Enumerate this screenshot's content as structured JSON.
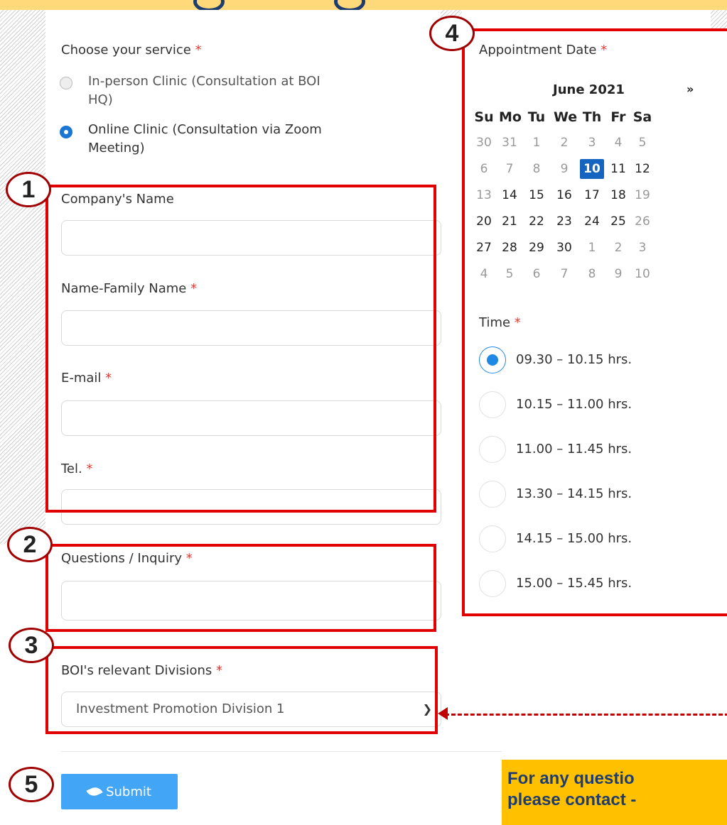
{
  "service": {
    "label": "Choose your service",
    "required_mark": "*",
    "options": [
      {
        "line1": "In-person Clinic (Consultation at BOI",
        "line2": "HQ)",
        "selected": false
      },
      {
        "line1": "Online Clinic (Consultation via Zoom",
        "line2": "Meeting)",
        "selected": true
      }
    ]
  },
  "fields": {
    "company_name": {
      "label": "Company's Name",
      "value": ""
    },
    "full_name": {
      "label": "Name-Family Name",
      "required_mark": "*",
      "value": ""
    },
    "email": {
      "label": "E-mail",
      "required_mark": "*",
      "value": ""
    },
    "tel": {
      "label": "Tel.",
      "required_mark": "*",
      "value": ""
    },
    "questions": {
      "label": "Questions / Inquiry",
      "required_mark": "*",
      "value": ""
    },
    "divisions": {
      "label": "BOI's relevant Divisions",
      "required_mark": "*",
      "selected": "Investment Promotion Division 1"
    }
  },
  "appointment": {
    "label": "Appointment Date",
    "required_mark": "*",
    "month": "June 2021",
    "next": "»",
    "weekdays": [
      "Su",
      "Mo",
      "Tu",
      "We",
      "Th",
      "Fr",
      "Sa"
    ],
    "weeks": [
      [
        "30",
        "31",
        "1",
        "2",
        "3",
        "4",
        "5"
      ],
      [
        "6",
        "7",
        "8",
        "9",
        "10",
        "11",
        "12"
      ],
      [
        "13",
        "14",
        "15",
        "16",
        "17",
        "18",
        "19"
      ],
      [
        "20",
        "21",
        "22",
        "23",
        "24",
        "25",
        "26"
      ],
      [
        "27",
        "28",
        "29",
        "30",
        "1",
        "2",
        "3"
      ],
      [
        "4",
        "5",
        "6",
        "7",
        "8",
        "9",
        "10"
      ]
    ],
    "selected_day": "10"
  },
  "time": {
    "label": "Time",
    "required_mark": "*",
    "slots": [
      "09.30 – 10.15 hrs.",
      "10.15 – 11.00 hrs.",
      "11.00 – 11.45 hrs.",
      "13.30 – 14.15 hrs.",
      "14.15 – 15.00 hrs.",
      "15.00 – 15.45 hrs."
    ],
    "selected_index": 0
  },
  "submit": {
    "label": "Submit"
  },
  "badges": [
    "1",
    "2",
    "3",
    "4",
    "5"
  ],
  "callout": {
    "line1": "For any questio",
    "line2": "please contact -"
  },
  "colors": {
    "accent": "#1976d2",
    "highlight": "#e00000",
    "callout_bg": "#ffc000",
    "callout_text": "#1f3c6e",
    "button": "#42a5f5"
  }
}
